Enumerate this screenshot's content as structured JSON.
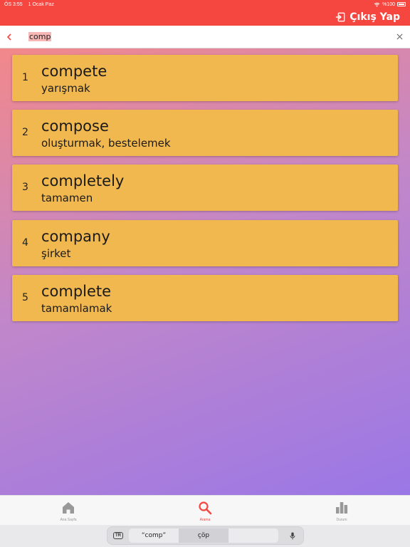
{
  "status": {
    "time": "ÖS 3:55",
    "date": "1 Ocak Paz",
    "battery": "%100"
  },
  "app_bar": {
    "logout_label": "Çıkış Yap"
  },
  "search": {
    "query": "comp"
  },
  "results": [
    {
      "index": "1",
      "word": "compete",
      "meaning": "yarışmak"
    },
    {
      "index": "2",
      "word": "compose",
      "meaning": "oluşturmak, bestelemek"
    },
    {
      "index": "3",
      "word": "completely",
      "meaning": "tamamen"
    },
    {
      "index": "4",
      "word": "company",
      "meaning": "şirket"
    },
    {
      "index": "5",
      "word": "complete",
      "meaning": "tamamlamak"
    }
  ],
  "tabs": [
    {
      "label": "Ana Sayfa",
      "icon": "home-icon"
    },
    {
      "label": "Arama",
      "icon": "search-icon"
    },
    {
      "label": "Durum",
      "icon": "bar-chart-icon"
    }
  ],
  "keyboard": {
    "lang": "TR",
    "suggestions": [
      "“comp”",
      "çöp",
      ""
    ]
  },
  "colors": {
    "primary": "#f54640",
    "card": "#f0b84f",
    "gradient_start": "#f2888a",
    "gradient_end": "#9a77e6"
  }
}
